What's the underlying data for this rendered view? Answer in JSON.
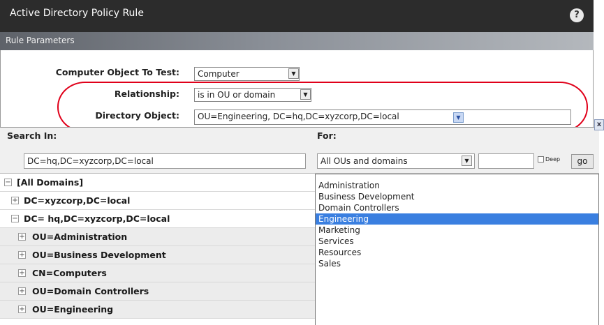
{
  "window": {
    "title": "Active Directory Policy Rule",
    "help_label": "?"
  },
  "section": {
    "title": "Rule Parameters"
  },
  "params": {
    "computer_object_label": "Computer Object To Test:",
    "computer_object_value": "Computer",
    "relationship_label": "Relationship:",
    "relationship_value": "is in OU or domain",
    "directory_object_label": "Directory Object:",
    "directory_object_value": "OU=Engineering, DC=hq,DC=xyzcorp,DC=local"
  },
  "browse": {
    "close_label": "x",
    "search_in_label": "Search In:",
    "search_in_value": "DC=hq,DC=xyzcorp,DC=local",
    "for_label": "For:",
    "for_value": "All OUs and domains",
    "filter_value": "",
    "deep_label": "Deep",
    "deep_checked": false,
    "go_label": "go"
  },
  "tree": [
    {
      "label": "[All Domains]",
      "toggle": "−"
    },
    {
      "label": "DC=xyzcorp,DC=local",
      "toggle": "+"
    },
    {
      "label": "DC= hq,DC=xyzcorp,DC=local",
      "toggle": "−"
    },
    {
      "label": "OU=Administration",
      "toggle": "+"
    },
    {
      "label": "OU=Business Development",
      "toggle": "+"
    },
    {
      "label": "CN=Computers",
      "toggle": "+"
    },
    {
      "label": "OU=Domain Controllers",
      "toggle": "+"
    },
    {
      "label": "OU=Engineering",
      "toggle": "+"
    }
  ],
  "results": {
    "items": [
      "Administration",
      "Business Development",
      "Domain Controllers",
      "Engineering",
      "Marketing",
      "Services",
      "Resources",
      "Sales"
    ],
    "selected": "Engineering"
  },
  "colors": {
    "selection": "#3a7fe0",
    "annotation": "#e0001a",
    "titlebar": "#2c2c2c"
  },
  "icons": {
    "help": "help-icon",
    "dropdown": "chevron-down-icon",
    "close": "close-icon",
    "expand": "plus-icon",
    "collapse": "minus-icon"
  }
}
